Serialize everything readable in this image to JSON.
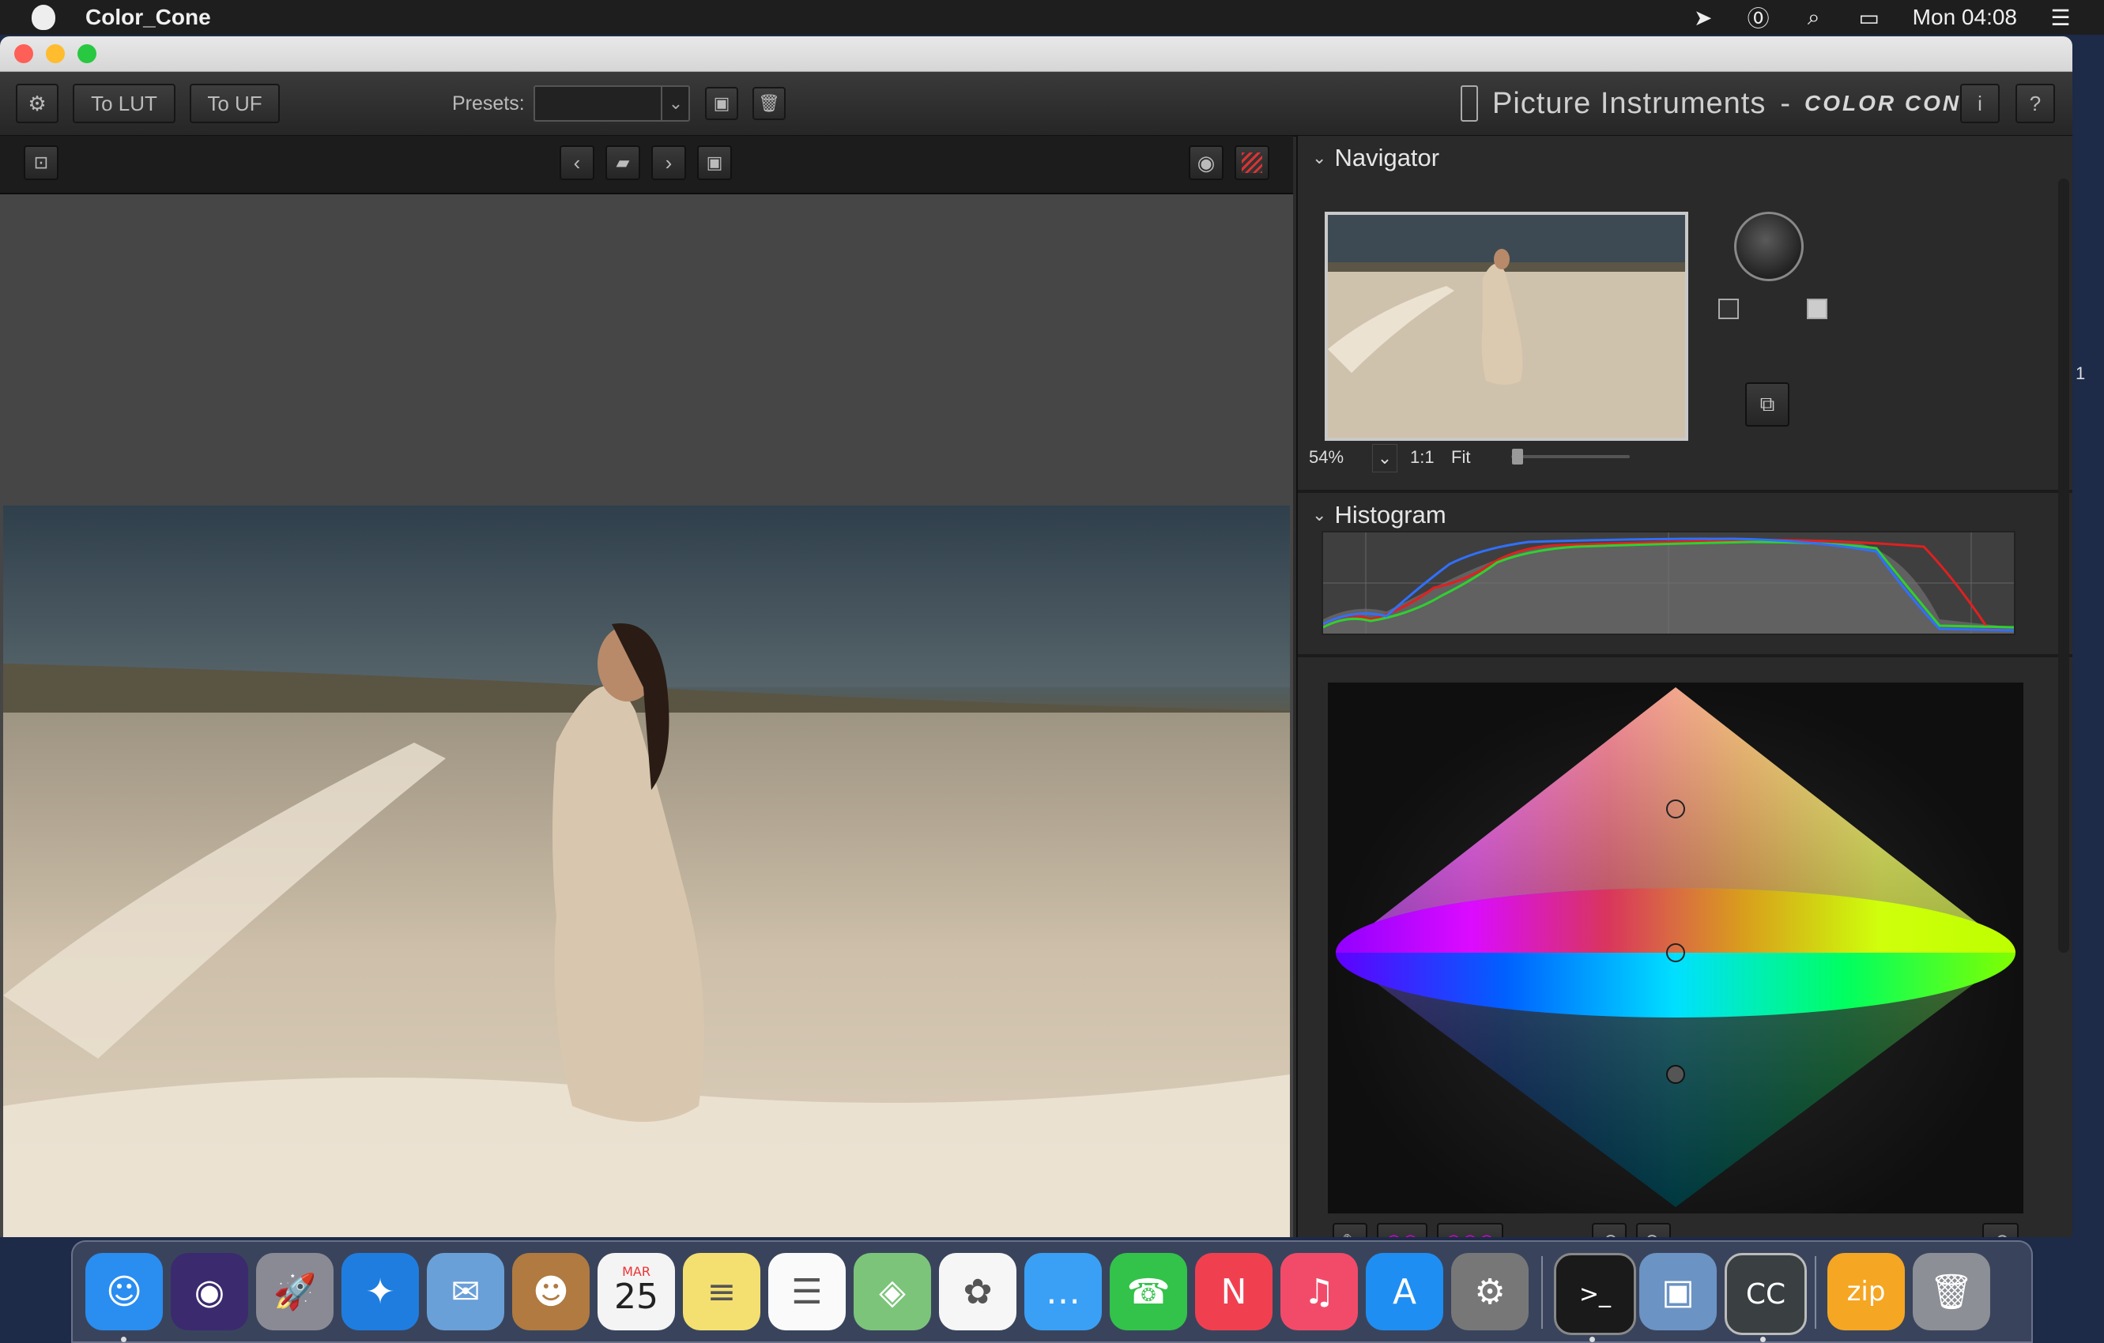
{
  "menubar": {
    "app_name": "Color_Cone",
    "clock": "Mon 04:08",
    "icons": [
      "location-arrow-icon",
      "password-manager-icon",
      "spotlight-search-icon",
      "display-mirroring-icon",
      "notification-center-icon"
    ]
  },
  "toolbar": {
    "to_lut_label": "To LUT",
    "to_uf_label": "To UF",
    "presets_label": "Presets:",
    "presets_value": "",
    "brand_name": "Picture Instruments",
    "brand_dash": "-",
    "product_name": "COLOR CONE",
    "info_label": "i",
    "help_label": "?"
  },
  "navigator": {
    "title": "Navigator",
    "zoom_value": "54%",
    "one_to_one_label": "1:1",
    "fit_label": "Fit",
    "zoom_slider_fraction": 0.05
  },
  "histogram": {
    "title": "Histogram",
    "channels": [
      "red",
      "green",
      "blue"
    ],
    "colors": {
      "red": "#e02020",
      "green": "#30d030",
      "blue": "#3070ff"
    }
  },
  "color_cone": {
    "handles": [
      "top",
      "middle",
      "bottom"
    ]
  },
  "edge_text": "1",
  "dock": {
    "apps": [
      {
        "name": "Finder",
        "icon": "finder-icon",
        "glyph": "☺",
        "color": "#2a8df0",
        "running": true
      },
      {
        "name": "Siri",
        "icon": "siri-icon",
        "glyph": "◉",
        "color": "#3b2b6e",
        "running": false
      },
      {
        "name": "Launchpad",
        "icon": "launchpad-icon",
        "glyph": "🚀",
        "color": "#8a8a95",
        "running": false
      },
      {
        "name": "Safari",
        "icon": "safari-icon",
        "glyph": "✦",
        "color": "#1f7de0",
        "running": false
      },
      {
        "name": "Mail",
        "icon": "mail-icon",
        "glyph": "✉",
        "color": "#6aa0d8",
        "running": false
      },
      {
        "name": "Contacts",
        "icon": "contacts-icon",
        "glyph": "☻",
        "color": "#b07a40",
        "running": false
      },
      {
        "name": "Calendar",
        "icon": "calendar-icon",
        "glyph": "25",
        "month": "MAR",
        "color": "#f4f4f4",
        "running": false
      },
      {
        "name": "Notes",
        "icon": "notes-icon",
        "glyph": "≡",
        "color": "#f4e070",
        "running": false
      },
      {
        "name": "Reminders",
        "icon": "reminders-icon",
        "glyph": "☰",
        "color": "#fafafa",
        "running": false
      },
      {
        "name": "Maps",
        "icon": "maps-icon",
        "glyph": "◈",
        "color": "#7cc47a",
        "running": false
      },
      {
        "name": "Photos",
        "icon": "photos-icon",
        "glyph": "✿",
        "color": "#f6f6f6",
        "running": false
      },
      {
        "name": "Messages",
        "icon": "messages-icon",
        "glyph": "…",
        "color": "#3aa0f5",
        "running": false
      },
      {
        "name": "FaceTime",
        "icon": "facetime-icon",
        "glyph": "☎",
        "color": "#33c24a",
        "running": false
      },
      {
        "name": "News",
        "icon": "news-icon",
        "glyph": "N",
        "color": "#f04050",
        "running": false
      },
      {
        "name": "Music",
        "icon": "music-icon",
        "glyph": "♫",
        "color": "#f24b6a",
        "running": false
      },
      {
        "name": "App Store",
        "icon": "app-store-icon",
        "glyph": "A",
        "color": "#1f8ef2",
        "running": false
      },
      {
        "name": "System Preferences",
        "icon": "system-preferences-icon",
        "glyph": "⚙",
        "color": "#777",
        "running": false
      },
      {
        "name": "Terminal",
        "icon": "terminal-icon",
        "glyph": ">_",
        "color": "#1a1a1a",
        "running": true
      },
      {
        "name": "Preview",
        "icon": "preview-icon",
        "glyph": "▣",
        "color": "#6b93c4",
        "running": false
      },
      {
        "name": "Color Cone",
        "icon": "color-cone-app-icon",
        "glyph": "CC",
        "color": "#3a3f42",
        "running": true
      },
      {
        "name": "Archive",
        "icon": "zip-archive-icon",
        "glyph": "zip",
        "color": "#f5a623",
        "running": false
      },
      {
        "name": "Trash",
        "icon": "trash-icon",
        "glyph": "🗑",
        "color": "#8c8f96",
        "running": false
      }
    ]
  }
}
